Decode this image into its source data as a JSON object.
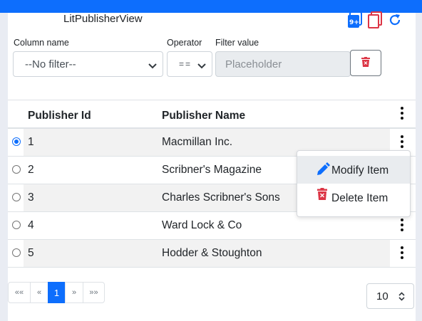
{
  "header": {
    "title": "LitPublisherView",
    "icons": [
      "export-icon",
      "copy-icon",
      "refresh-icon"
    ],
    "accent_color": "#0d6efd",
    "danger_color": "#dc3545"
  },
  "filter": {
    "column_label": "Column name",
    "column_value": "--No filter--",
    "operator_label": "Operator",
    "operator_value": "==",
    "value_label": "Filter value",
    "value_placeholder": "Placeholder"
  },
  "table": {
    "columns": [
      "Publisher Id",
      "Publisher Name"
    ],
    "rows": [
      {
        "id": "1",
        "name": "Macmillan Inc.",
        "selected": true
      },
      {
        "id": "2",
        "name": "Scribner's Magazine",
        "selected": false
      },
      {
        "id": "3",
        "name": "Charles Scribner's Sons",
        "selected": false
      },
      {
        "id": "4",
        "name": "Ward Lock & Co",
        "selected": false
      },
      {
        "id": "5",
        "name": "Hodder & Stoughton",
        "selected": false
      }
    ]
  },
  "context_menu": {
    "modify_label": "Modify Item",
    "delete_label": "Delete Item"
  },
  "pagination": {
    "first": "««",
    "prev": "«",
    "current": "1",
    "next": "»",
    "last": "»»",
    "page_size": "10"
  }
}
